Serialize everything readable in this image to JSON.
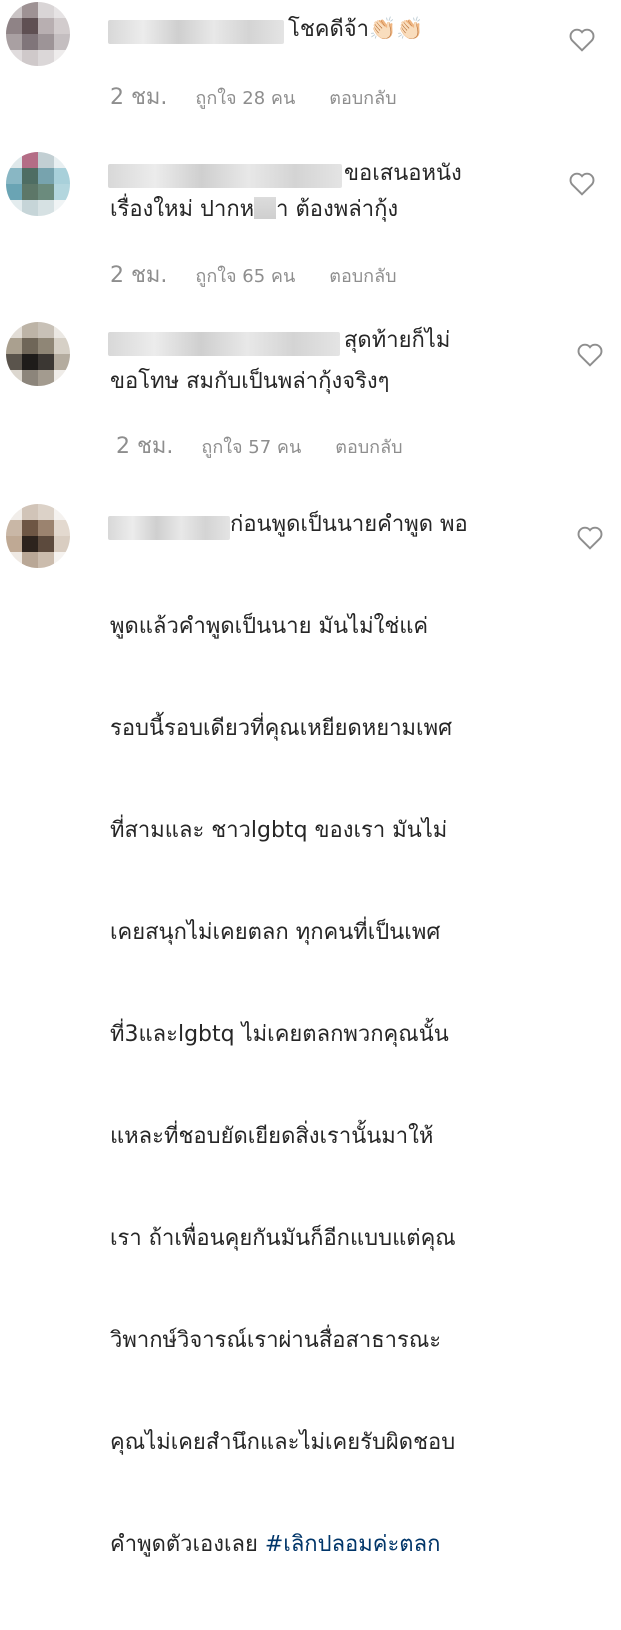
{
  "comments": [
    {
      "text_line1": "โชคดีจ้า👏🏻👏🏻",
      "time": "2 ชม.",
      "likes": "ถูกใจ 28 คน",
      "reply": "ตอบกลับ"
    },
    {
      "text_line1": "ขอเสนอหนัง",
      "text_line2a": "เรื่องใหม่ ปากห",
      "text_line2b": "า ต้องพล่ากุ้ง",
      "time": "2 ชม.",
      "likes": "ถูกใจ 65 คน",
      "reply": "ตอบกลับ"
    },
    {
      "text_line1": "สุดท้ายก็ไม่",
      "text_line2": "ขอโทษ สมกับเป็นพล่ากุ้งจริงๆ",
      "time": "2 ชม.",
      "likes": "ถูกใจ 57 คน",
      "reply": "ตอบกลับ"
    },
    {
      "text_line1": "ก่อนพูดเป็นนายคำพูด พอ",
      "lines": [
        "พูดแล้วคำพูดเป็นนาย มันไม่ใช่แค่",
        "รอบนี้รอบเดียวที่คุณเหยียดหยามเพศ",
        "ที่สามและ ชาวlgbtq ของเรา มันไม่",
        "เคยสนุกไม่เคยตลก ทุกคนที่เป็นเพศ",
        "ที่3และlgbtq ไม่เคยตลกพวกคุณนั้น",
        "แหละที่ชอบยัดเยียดสิ่งเรานั้นมาให้",
        "เรา ถ้าเพื่อนคุยกันมันก็อีกแบบแต่คุณ",
        "วิพากษ์วิจารณ์เราผ่านสื่อสาธารณะ",
        "คุณไม่เคยสำนึกและไม่เคยรับผิดชอบ"
      ],
      "last_line_text": "คำพูดตัวเองเลย ",
      "hashtag": "#เลิกปลอมค่ะตลก"
    }
  ],
  "icons": {
    "like": "heart-outline-icon"
  },
  "colors": {
    "text": "#262626",
    "meta": "#8e8e8e",
    "hashtag": "#003569"
  }
}
